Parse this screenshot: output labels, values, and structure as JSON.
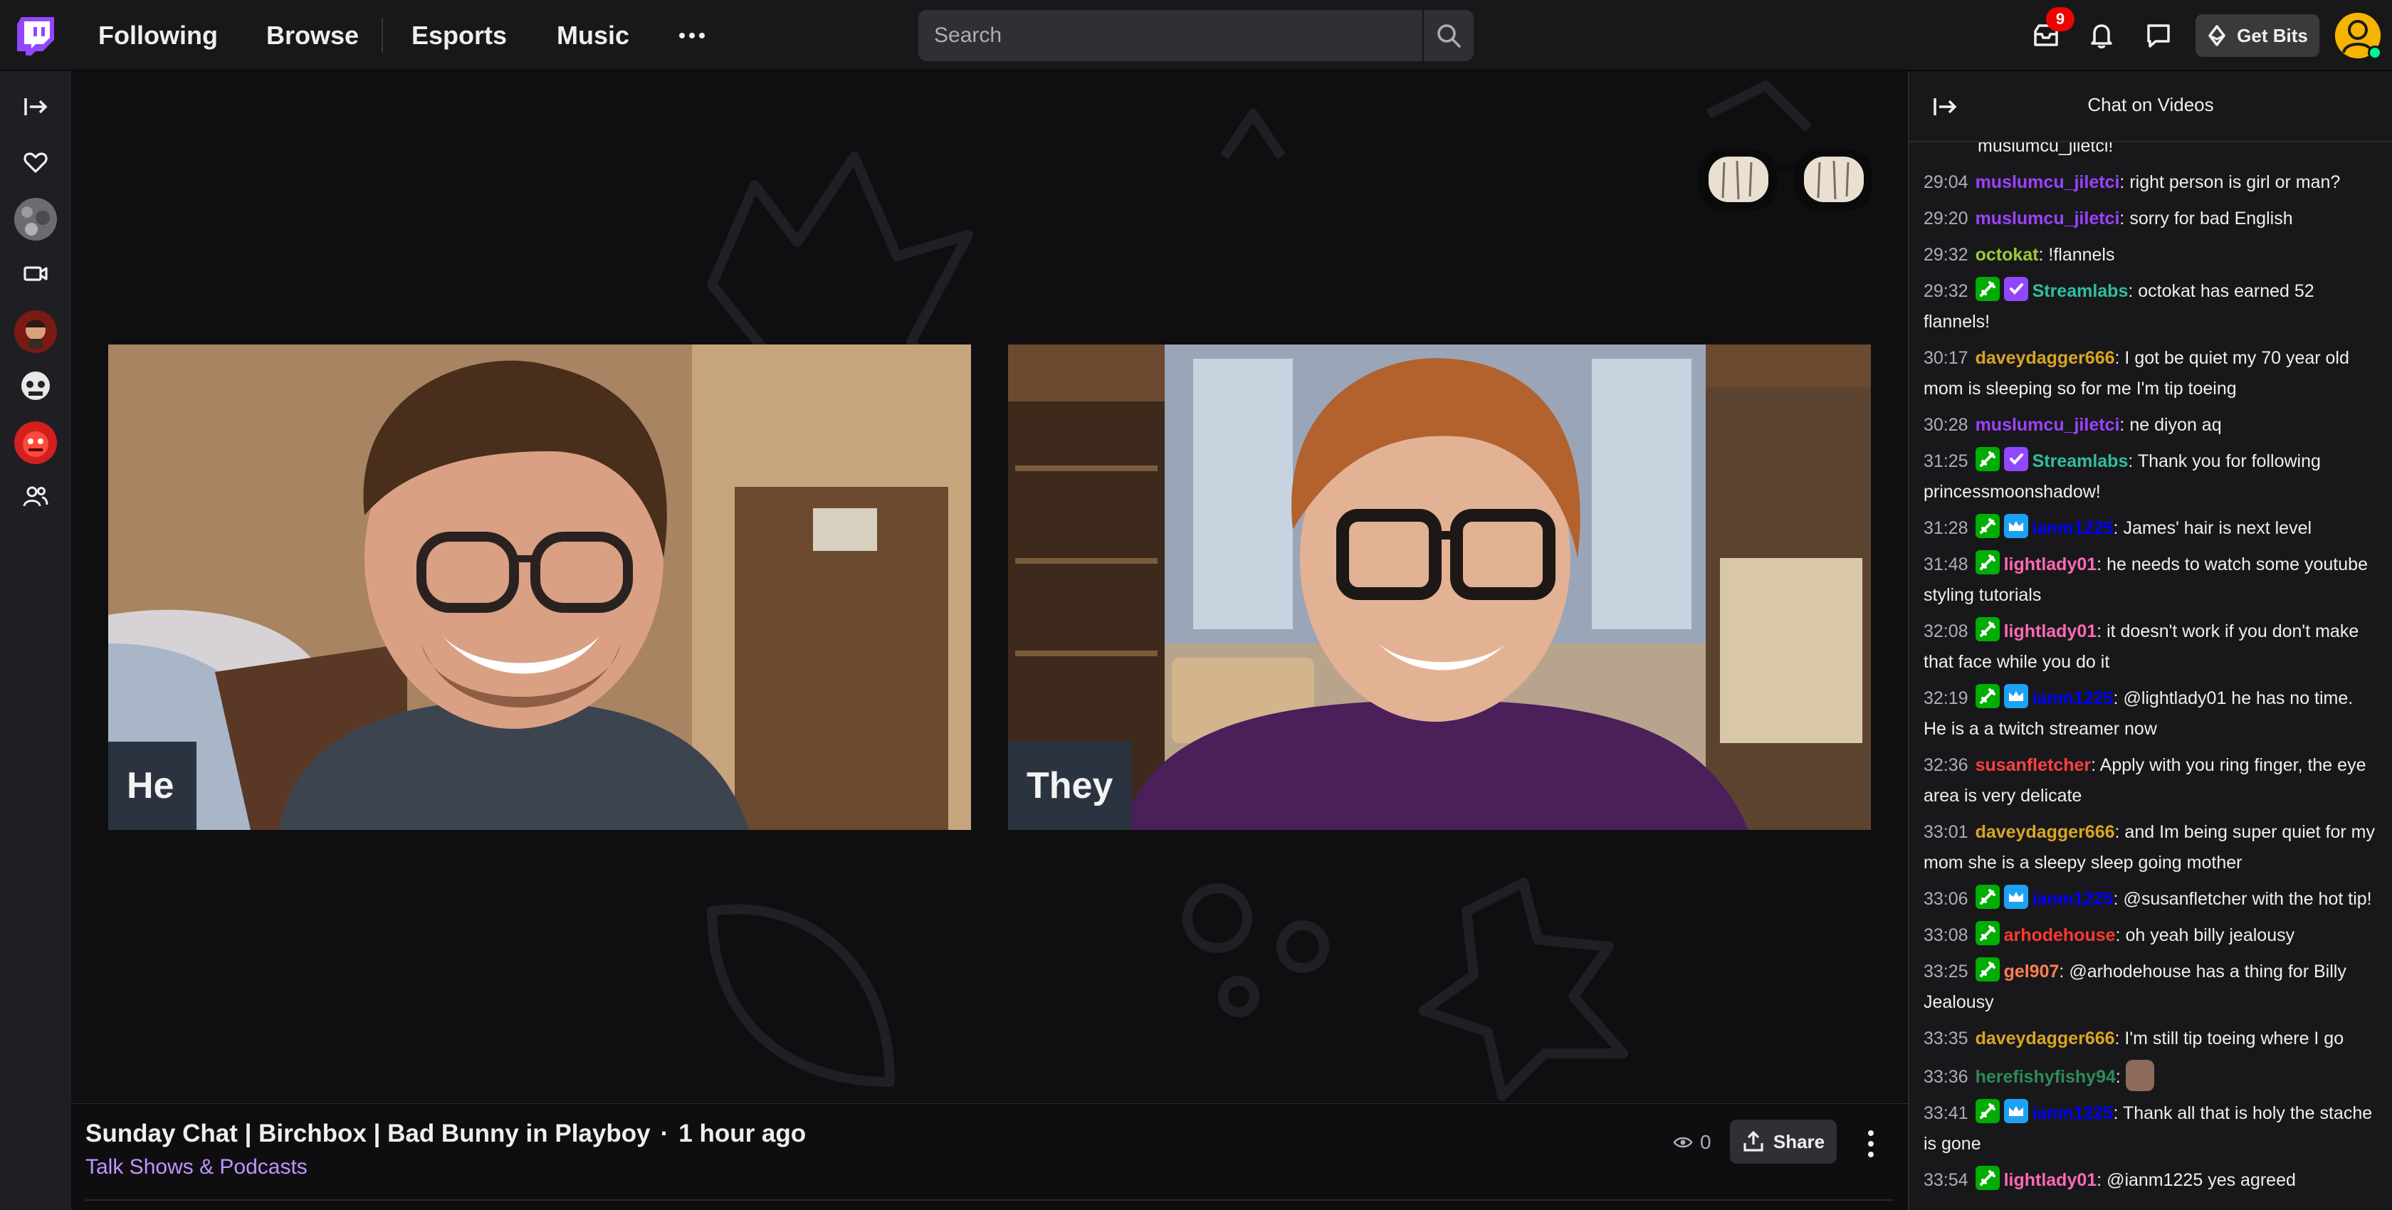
{
  "nav": {
    "links": [
      "Following",
      "Browse",
      "Esports",
      "Music"
    ],
    "search_placeholder": "Search",
    "inbox_count": "9",
    "get_bits": "Get Bits"
  },
  "player": {
    "cams": [
      {
        "name": "He"
      },
      {
        "name": "They"
      }
    ]
  },
  "video": {
    "title": "Sunday Chat | Birchbox | Bad Bunny in Playboy",
    "separator": "·",
    "age": "1 hour ago",
    "category": "Talk Shows & Podcasts",
    "viewer_count": "0",
    "share_label": "Share"
  },
  "chat": {
    "title": "Chat on Videos",
    "top_fragment": "muslumcu_jiletci!",
    "messages": [
      {
        "time": "29:04",
        "user": "muslumcu_jiletci",
        "color": "#9b42ff",
        "badges": [],
        "text": "right person is girl or man?"
      },
      {
        "time": "29:20",
        "user": "muslumcu_jiletci",
        "color": "#9b42ff",
        "badges": [],
        "text": "sorry for bad English"
      },
      {
        "time": "29:32",
        "user": "octokat",
        "color": "#9acd32",
        "badges": [],
        "text": "!flannels"
      },
      {
        "time": "29:32",
        "user": "Streamlabs",
        "color": "#2fbfa0",
        "badges": [
          "mod",
          "verified"
        ],
        "text": "octokat has earned 52 flannels!"
      },
      {
        "time": "30:17",
        "user": "daveydagger666",
        "color": "#daa520",
        "badges": [],
        "text": "I got be quiet my 70 year old mom is sleeping so for me I'm tip toeing"
      },
      {
        "time": "30:28",
        "user": "muslumcu_jiletci",
        "color": "#9b42ff",
        "badges": [],
        "text": "ne diyon aq"
      },
      {
        "time": "31:25",
        "user": "Streamlabs",
        "color": "#2fbfa0",
        "badges": [
          "mod",
          "verified"
        ],
        "text": "Thank you for following princessmoonshadow!"
      },
      {
        "time": "31:28",
        "user": "ianm1225",
        "color": "#0000ff",
        "badges": [
          "mod",
          "prime"
        ],
        "text": "James' hair is next level"
      },
      {
        "time": "31:48",
        "user": "lightlady01",
        "color": "#ff69b4",
        "badges": [
          "mod"
        ],
        "text": "he needs to watch some youtube styling tutorials"
      },
      {
        "time": "32:08",
        "user": "lightlady01",
        "color": "#ff69b4",
        "badges": [
          "mod"
        ],
        "text": "it doesn't work if you don't make that face while you do it"
      },
      {
        "time": "32:19",
        "user": "ianm1225",
        "color": "#0000ff",
        "badges": [
          "mod",
          "prime"
        ],
        "text": "@lightlady01 he has no time. He is a a twitch streamer now"
      },
      {
        "time": "32:36",
        "user": "susanfletcher",
        "color": "#ff4040",
        "badges": [],
        "text": "Apply with you ring finger, the eye area is very delicate"
      },
      {
        "time": "33:01",
        "user": "daveydagger666",
        "color": "#daa520",
        "badges": [],
        "text": "and Im being super quiet for my mom she is a sleepy sleep going mother"
      },
      {
        "time": "33:06",
        "user": "ianm1225",
        "color": "#0000ff",
        "badges": [
          "mod",
          "prime"
        ],
        "text": "@susanfletcher with the hot tip!"
      },
      {
        "time": "33:08",
        "user": "arhodehouse",
        "color": "#ff3a2f",
        "badges": [
          "mod"
        ],
        "text": "oh yeah billy jealousy"
      },
      {
        "time": "33:25",
        "user": "gel907",
        "color": "#ff7f50",
        "badges": [
          "mod"
        ],
        "text": "@arhodehouse has a thing for Billy Jealousy"
      },
      {
        "time": "33:35",
        "user": "daveydagger666",
        "color": "#daa520",
        "badges": [],
        "text": "I'm still tip toeing where I go"
      },
      {
        "time": "33:36",
        "user": "herefishyfishy94",
        "color": "#2e8b57",
        "badges": [],
        "text": "",
        "emote": true
      },
      {
        "time": "33:41",
        "user": "ianm1225",
        "color": "#0000ff",
        "badges": [
          "mod",
          "prime"
        ],
        "text": "Thank all that is holy the stache is gone"
      },
      {
        "time": "33:54",
        "user": "lightlady01",
        "color": "#ff69b4",
        "badges": [
          "mod"
        ],
        "text": "@ianm1225 yes agreed"
      }
    ]
  },
  "colors": {
    "accent": "#9147ff",
    "category_link": "#bf94ff",
    "badge_red": "#eb0400",
    "mod_badge": "#00ad03",
    "prime_badge": "#1da1f2"
  },
  "icons": {
    "logo": "twitch-logo-icon",
    "inbox": "inbox-icon",
    "notifications": "bell-icon",
    "whispers": "chat-bubble-icon",
    "bits": "bits-diamond-icon"
  }
}
